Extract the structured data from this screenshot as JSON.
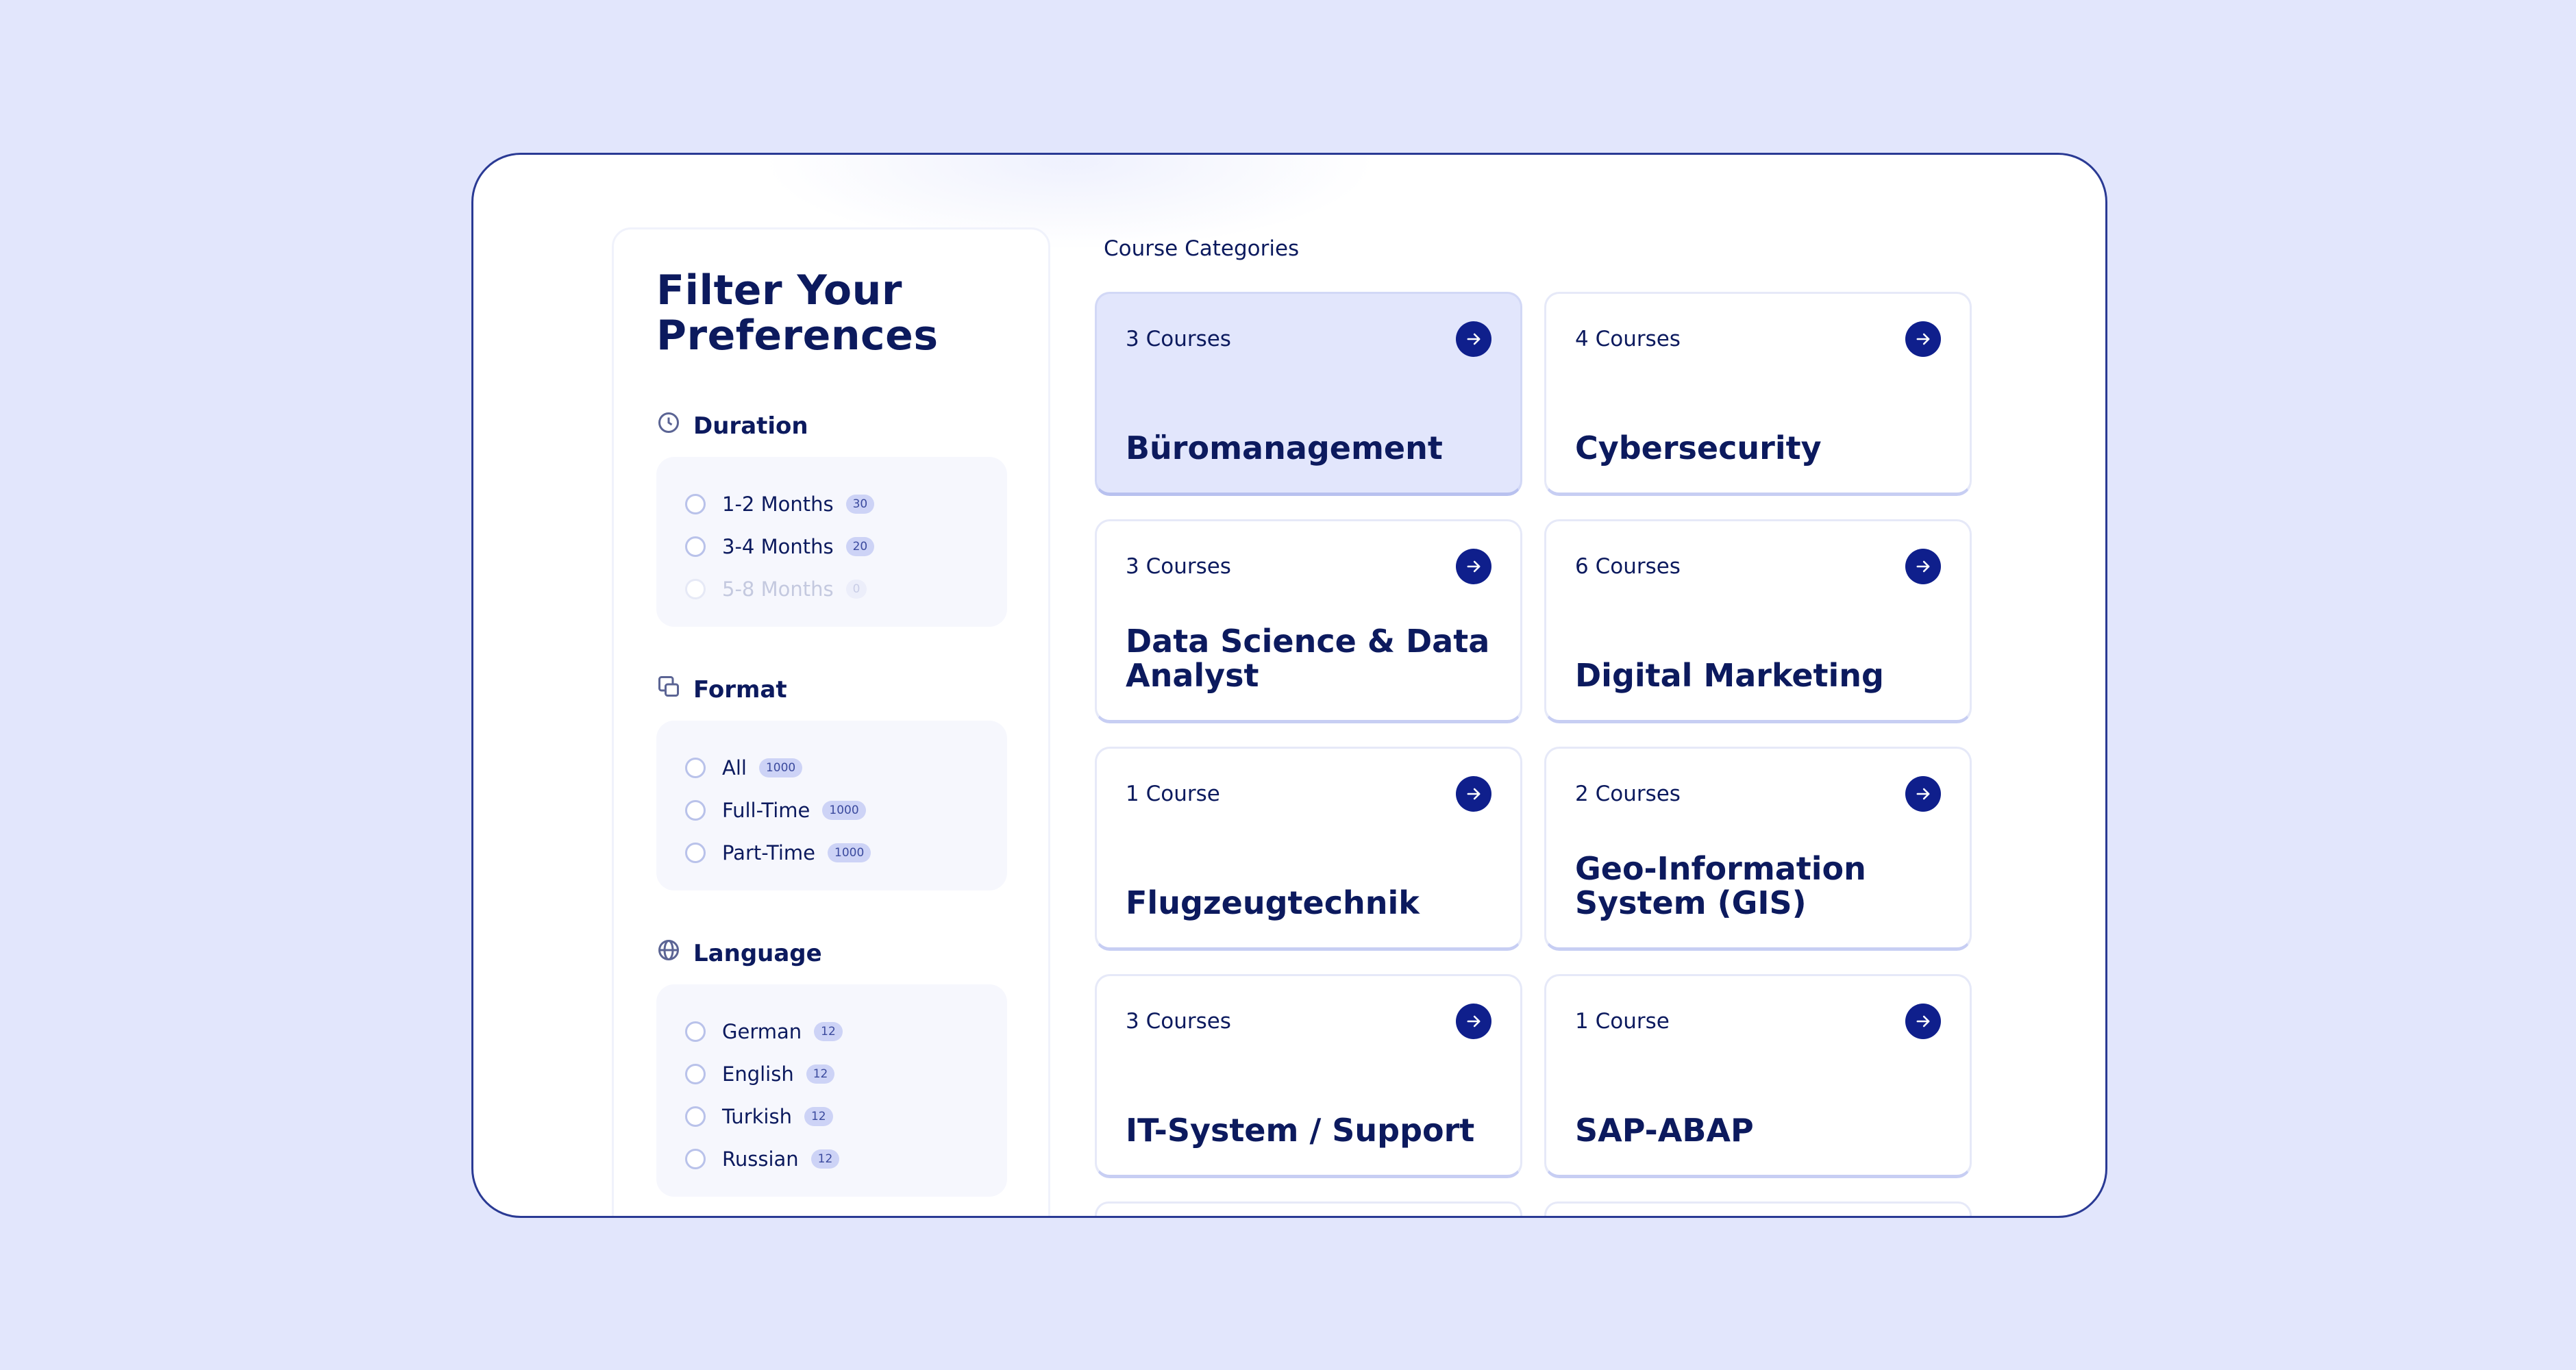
{
  "sidebar": {
    "title": "Filter Your Preferences",
    "sections": {
      "duration": {
        "label": "Duration",
        "options": [
          {
            "label": "1-2 Months",
            "count": "30"
          },
          {
            "label": "3-4 Months",
            "count": "20"
          },
          {
            "label": "5-8 Months",
            "count": "0"
          }
        ]
      },
      "format": {
        "label": "Format",
        "options": [
          {
            "label": "All",
            "count": "1000"
          },
          {
            "label": "Full-Time",
            "count": "1000"
          },
          {
            "label": "Part-Time",
            "count": "1000"
          }
        ]
      },
      "language": {
        "label": "Language",
        "options": [
          {
            "label": "German",
            "count": "12"
          },
          {
            "label": "English",
            "count": "12"
          },
          {
            "label": "Turkish",
            "count": "12"
          },
          {
            "label": "Russian",
            "count": "12"
          }
        ]
      }
    }
  },
  "main": {
    "heading": "Course Categories",
    "cards": [
      {
        "count": "3 Courses",
        "name": "Büromanagement"
      },
      {
        "count": "4 Courses",
        "name": "Cybersecurity"
      },
      {
        "count": "3 Courses",
        "name": "Data Science & Data Analyst"
      },
      {
        "count": "6 Courses",
        "name": "Digital Marketing"
      },
      {
        "count": "1 Course",
        "name": "Flugzeugtechnik"
      },
      {
        "count": "2 Courses",
        "name": "Geo-Information System (GIS)"
      },
      {
        "count": "3 Courses",
        "name": "IT-System / Support"
      },
      {
        "count": "1 Course",
        "name": "SAP-ABAP"
      }
    ]
  },
  "colors": {
    "background": "#e2e6fc",
    "accent": "#0f1f8c",
    "text": "#0c1a5e",
    "active_card": "#e2e6fc"
  },
  "icons": {
    "duration": "clock-icon",
    "format": "format-icon",
    "language": "globe-icon",
    "card_action": "arrow-right-icon"
  }
}
